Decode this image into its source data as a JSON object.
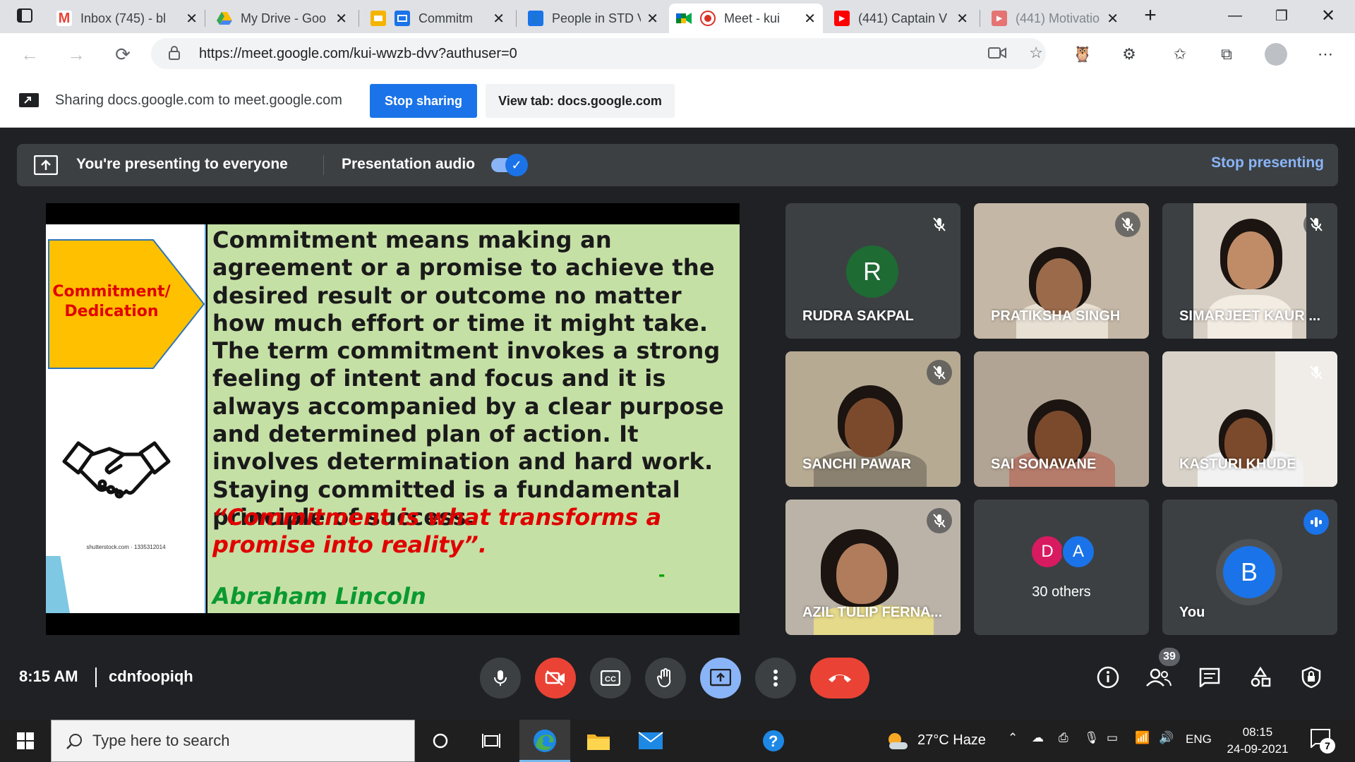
{
  "browser": {
    "tabs": [
      {
        "title": "Inbox (745) - bl",
        "icon": "gmail-icon"
      },
      {
        "title": "My Drive - Goo",
        "icon": "drive-icon"
      },
      {
        "title": "Commitm",
        "icon": "slides-icon"
      },
      {
        "title": "People in STD V",
        "icon": "classroom-icon"
      },
      {
        "title": "Meet - kui",
        "icon": "meet-icon"
      },
      {
        "title": "(441) Captain V",
        "icon": "youtube-icon"
      },
      {
        "title": "(441) Motivatio",
        "icon": "youtube-icon"
      }
    ],
    "url": "https://meet.google.com/kui-wwzb-dvv?authuser=0"
  },
  "sharebar": {
    "text": "Sharing docs.google.com to meet.google.com",
    "stop_label": "Stop sharing",
    "view_label": "View tab: docs.google.com"
  },
  "presenting": {
    "text": "You're presenting to everyone",
    "audio_label": "Presentation audio",
    "audio_on": true,
    "stop_label": "Stop presenting"
  },
  "slide": {
    "arrow_label": "Commitment/ Dedication",
    "body": "Commitment means making an agreement or a promise to achieve the desired result or outcome no matter how much effort or time it might take. The term commitment invokes a strong feeling of intent and focus and it is always accompanied by a clear purpose and determined plan of action. It involves determination and hard work. Staying committed is a fundamental principle of success.",
    "quote": "“Commitment is what transforms a promise into reality”.",
    "dash": "-",
    "author": "Abraham Lincoln",
    "stock_credit": "shutterstock.com · 1335312014"
  },
  "participants": [
    {
      "name": "RUDRA SAKPAL",
      "initial": "R",
      "muted": true,
      "camera": false,
      "avatar_color": "#1e6b34"
    },
    {
      "name": "PRATIKSHA SINGH",
      "muted": true,
      "camera": true
    },
    {
      "name": "SIMARJEET KAUR ...",
      "muted": true,
      "camera": true
    },
    {
      "name": "SANCHI PAWAR",
      "muted": true,
      "camera": true
    },
    {
      "name": "SAI SONAVANE",
      "muted": false,
      "camera": true
    },
    {
      "name": "KASTURI KHUDE",
      "muted": true,
      "camera": true
    },
    {
      "name": "AZIL TULIP FERNA...",
      "muted": true,
      "camera": true
    }
  ],
  "others": {
    "initials": [
      "D",
      "A"
    ],
    "colors": [
      "#d81b60",
      "#1a73e8"
    ],
    "label": "30 others"
  },
  "self": {
    "initial": "B",
    "label": "You",
    "avatar_color": "#1a73e8"
  },
  "meeting": {
    "time": "8:15 AM",
    "code": "cdnfoopiqh",
    "people_count": "39"
  },
  "taskbar": {
    "search_placeholder": "Type here to search",
    "weather": "27°C  Haze",
    "language": "ENG",
    "clock_time": "08:15",
    "clock_date": "24-09-2021",
    "notification_count": "7"
  }
}
